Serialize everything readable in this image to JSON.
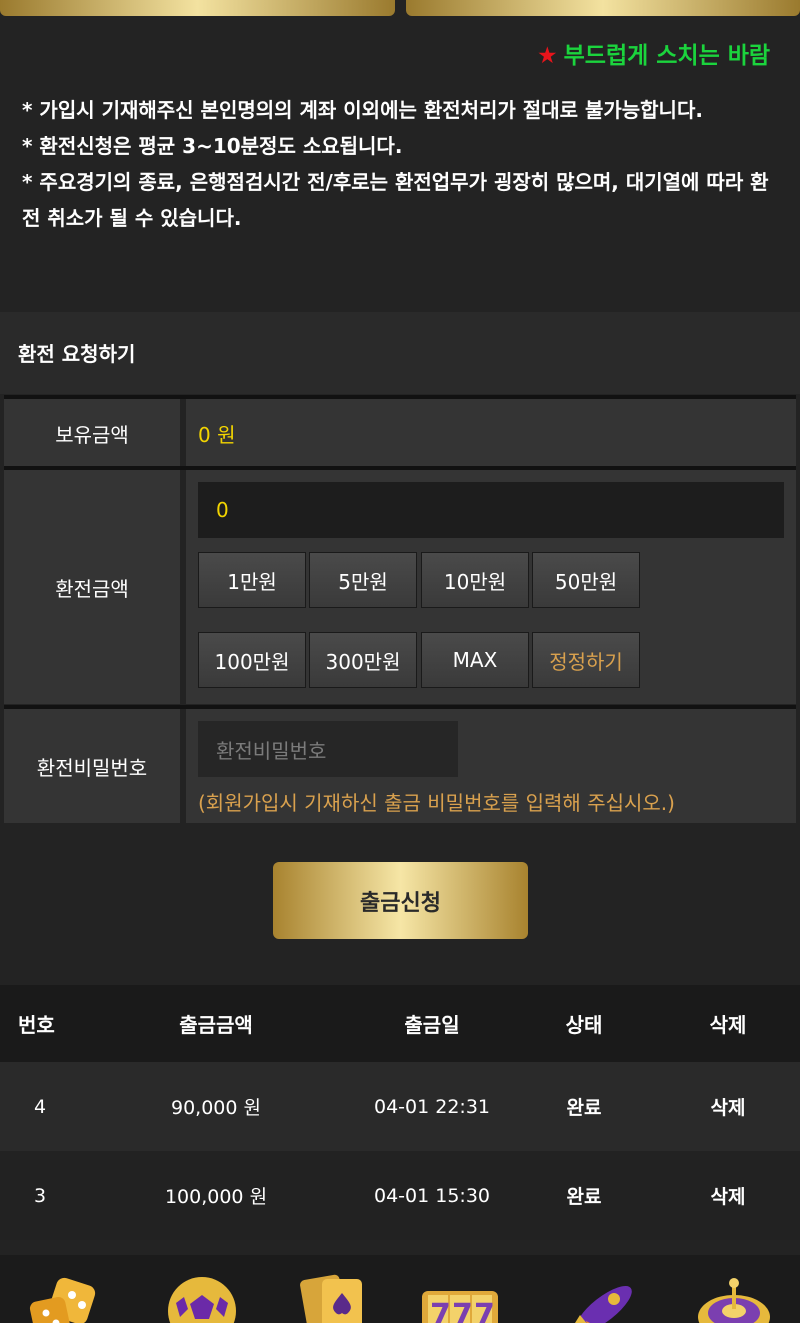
{
  "ticker": {
    "star": "★",
    "text": "부드럽게 스치는 바람"
  },
  "notice": {
    "lines": [
      "* 가입시 기재해주신 본인명의의 계좌 이외에는 환전처리가 절대로 불가능합니다.",
      "* 환전신청은 평균 3~10분정도 소요됩니다.",
      "* 주요경기의 종료, 은행점검시간 전/후로는 환전업무가 굉장히 많으며, 대기열에 따라 환전 취소가 될 수 있습니다."
    ]
  },
  "form": {
    "title": "환전 요청하기",
    "balance_label": "보유금액",
    "balance_value": "0 원",
    "amount_label": "환전금액",
    "amount_value": "0",
    "quick_buttons": [
      "1만원",
      "5만원",
      "10만원",
      "50만원",
      "100만원",
      "300만원",
      "MAX",
      "정정하기"
    ],
    "password_label": "환전비밀번호",
    "password_placeholder": "환전비밀번호",
    "password_hint": "(회원가입시 기재하신 출금 비밀번호를 입력해 주십시오.)",
    "submit_label": "출금신청"
  },
  "table": {
    "headers": [
      "번호",
      "출금금액",
      "출금일",
      "상태",
      "삭제"
    ],
    "rows": [
      {
        "no": "4",
        "amount": "90,000 원",
        "date": "04-01 22:31",
        "status": "완료",
        "action": "삭제"
      },
      {
        "no": "3",
        "amount": "100,000 원",
        "date": "04-01 15:30",
        "status": "완료",
        "action": "삭제"
      }
    ]
  },
  "colors": {
    "gold": "#f3e2a0",
    "accent_yellow": "#f2d400",
    "ticker_green": "#1bd43d",
    "hint_orange": "#d9a14e"
  },
  "bottom_icons": [
    "dice-icon",
    "soccer-ball-icon",
    "playing-cards-icon",
    "slot-777-icon",
    "rocket-icon",
    "roulette-icon"
  ]
}
